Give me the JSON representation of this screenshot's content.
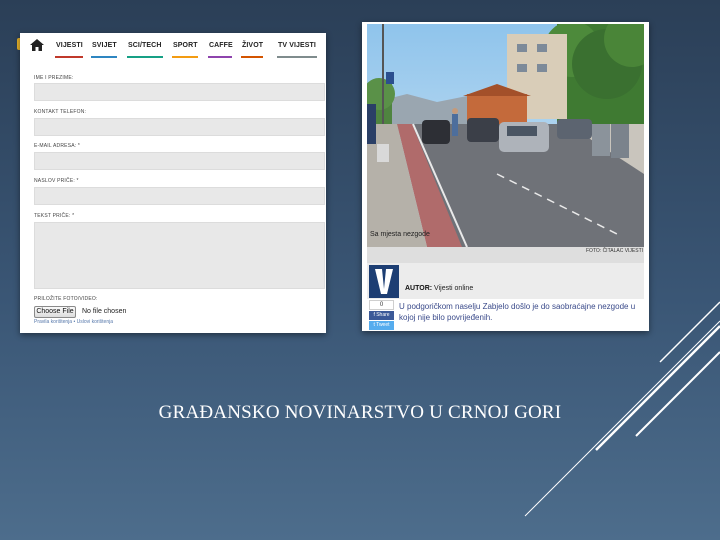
{
  "slide": {
    "title": "GRAĐANSKO NOVINARSTVO U CRNOJ GORI",
    "background_color": "#3a5675",
    "accent_line_color": "#ffffff"
  },
  "form_screenshot": {
    "nav": {
      "home_icon": "home-icon",
      "items": [
        "VIJESTI",
        "SVIJET",
        "SCI/TECH",
        "SPORT",
        "CAFFE",
        "ŽIVOT",
        "TV VIJESTI"
      ],
      "underline_colors": [
        "#c0392b",
        "#2e86c1",
        "#16a085",
        "#f39c12",
        "#8e44ad",
        "#d35400",
        "#7f8c8d"
      ]
    },
    "fields": [
      {
        "label": "IME I PREZIME:"
      },
      {
        "label": "KONTAKT TELEFON:"
      },
      {
        "label": "E-MAIL ADRESA: *"
      },
      {
        "label": "NASLOV PRIČE: *"
      },
      {
        "label": "TEKST PRIČE: *"
      }
    ],
    "upload": {
      "label": "PRILOŽITE FOTO/VIDEO:",
      "button": "Choose File",
      "status": "No file chosen",
      "terms": "Pravila korištenja • Uslovi korištenja"
    }
  },
  "article_screenshot": {
    "caption": "Sa mjesta nezgode",
    "photo_credit": "FOTO: ČITALAC VIJESTI",
    "logo_letter": "V",
    "author_label": "AUTOR:",
    "author_name": "Vijesti online",
    "share_count": "0",
    "share_label": "Share",
    "tweet_label": "Tweet",
    "lead": "U podgoričkom naselju Zabjelo došlo je do saobraćajne nezgode u kojoj nije bilo povrijeđenih."
  }
}
